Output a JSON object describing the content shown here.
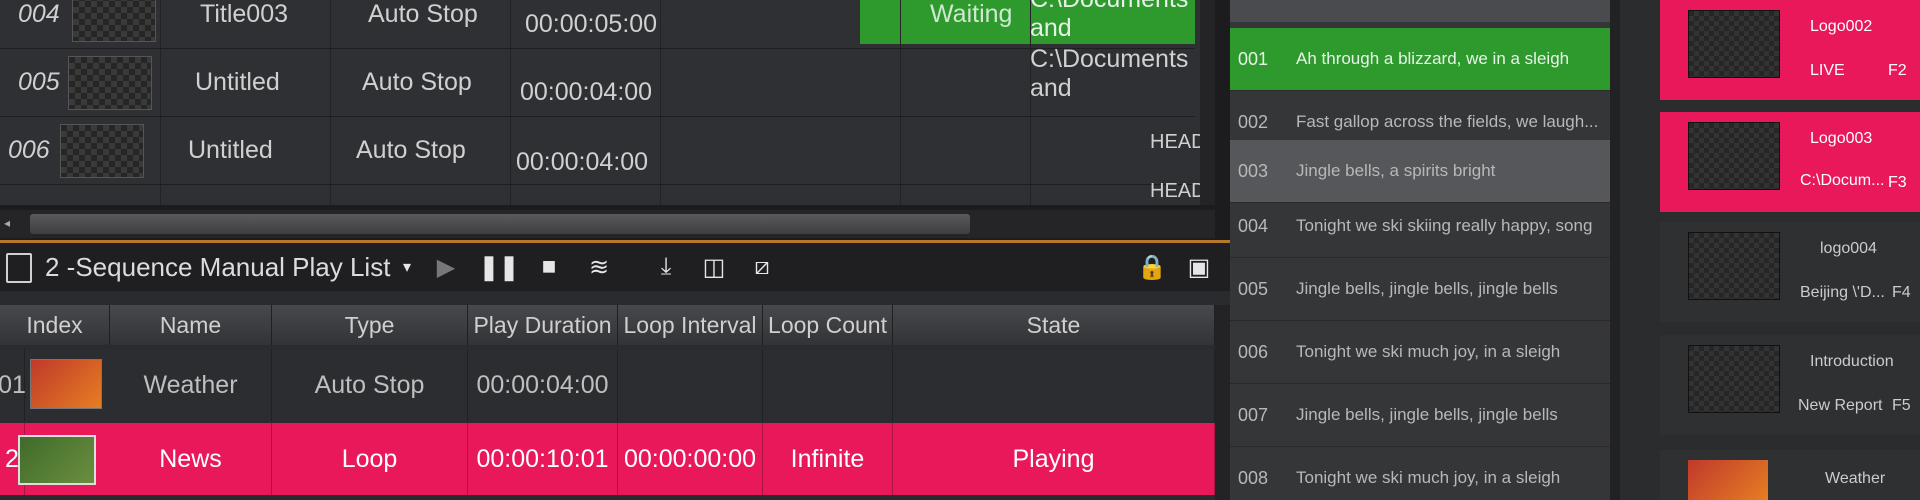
{
  "top_list": {
    "rows": [
      {
        "index": "004",
        "name": "Title003",
        "type": "Auto Stop",
        "duration": "00:00:05:00",
        "state": "Waiting",
        "path": "C:\\Documents and"
      },
      {
        "index": "005",
        "name": "Untitled",
        "type": "Auto Stop",
        "duration": "00:00:04:00",
        "state": "",
        "path": "C:\\Documents and"
      },
      {
        "index": "006",
        "name": "Untitled",
        "type": "Auto Stop",
        "duration": "00:00:04:00",
        "state": "",
        "path": "HEAD"
      }
    ],
    "extra_path": "HEAD"
  },
  "sequence": {
    "title": "2 -Sequence Manual Play List",
    "columns": [
      "Index",
      "Name",
      "Type",
      "Play Duration",
      "Loop Interval",
      "Loop Count",
      "State"
    ],
    "rows": [
      {
        "index": "01",
        "name": "Weather",
        "type": "Auto Stop",
        "duration": "00:00:04:00",
        "interval": "",
        "count": "",
        "state": ""
      },
      {
        "index": "2",
        "name": "News",
        "type": "Loop",
        "duration": "00:00:10:01",
        "interval": "00:00:00:00",
        "count": "Infinite",
        "state": "Playing"
      }
    ],
    "icons": [
      "dropdown-icon",
      "play-icon",
      "pause-icon",
      "stop-icon",
      "wave-icon",
      "download-icon",
      "split-icon",
      "slash-icon",
      "lock-icon",
      "window-icon"
    ]
  },
  "lyrics": {
    "rows": [
      {
        "num": "",
        "text": ""
      },
      {
        "num": "001",
        "text": "Ah through a blizzard, we in a sleigh"
      },
      {
        "num": "002",
        "text": "Fast gallop across the fields, we laugh..."
      },
      {
        "num": "003",
        "text": "Jingle bells, a spirits bright"
      },
      {
        "num": "004",
        "text": "Tonight we ski skiing really happy, song"
      },
      {
        "num": "005",
        "text": "Jingle bells, jingle bells, jingle bells"
      },
      {
        "num": "006",
        "text": "Tonight we ski much joy, in a sleigh"
      },
      {
        "num": "007",
        "text": "Jingle bells, jingle bells, jingle bells"
      },
      {
        "num": "008",
        "text": "Tonight we ski much joy, in a sleigh"
      }
    ]
  },
  "logos": {
    "cards": [
      {
        "title": "Logo002",
        "sub": "LIVE",
        "key": "F2",
        "highlight": true
      },
      {
        "title": "Logo003",
        "sub": "C:\\Docum...",
        "key": "F3",
        "highlight": true
      },
      {
        "title": "logo004",
        "sub": "Beijing \\'D...",
        "key": "F4",
        "highlight": false
      },
      {
        "title": "Introduction",
        "sub": "New Report",
        "key": "F5",
        "highlight": false
      },
      {
        "title": "Weather",
        "sub": "",
        "key": "",
        "highlight": false
      }
    ]
  },
  "colors": {
    "green": "#2e9a2e",
    "pink": "#e8185a",
    "orange": "#b5782c"
  }
}
